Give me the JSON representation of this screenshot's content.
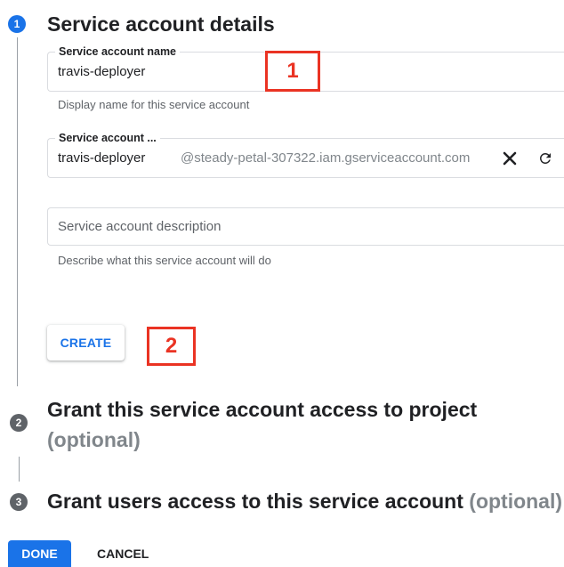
{
  "steps": [
    {
      "number": "1",
      "title": "Service account details"
    },
    {
      "number": "2",
      "title": "Grant this service account access to project",
      "optional": "(optional)"
    },
    {
      "number": "3",
      "title": "Grant users access to this service account",
      "optional": "(optional)"
    }
  ],
  "form": {
    "name_field": {
      "label": "Service account name",
      "value": "travis-deployer",
      "hint": "Display name for this service account"
    },
    "id_field": {
      "label": "Service account ...",
      "value": "travis-deployer",
      "suffix": "@steady-petal-307322.iam.gserviceaccount.com",
      "clear_icon": "close-icon",
      "refresh_icon": "refresh-icon"
    },
    "description_field": {
      "placeholder": "Service account description",
      "hint": "Describe what this service account will do"
    },
    "create_label": "CREATE"
  },
  "annotations": {
    "box1": "1",
    "box2": "2"
  },
  "footer": {
    "done_label": "DONE",
    "cancel_label": "CANCEL"
  },
  "colors": {
    "accent": "#1a73e8",
    "annotation": "#ea3323",
    "inactive_step": "#5f6368"
  }
}
